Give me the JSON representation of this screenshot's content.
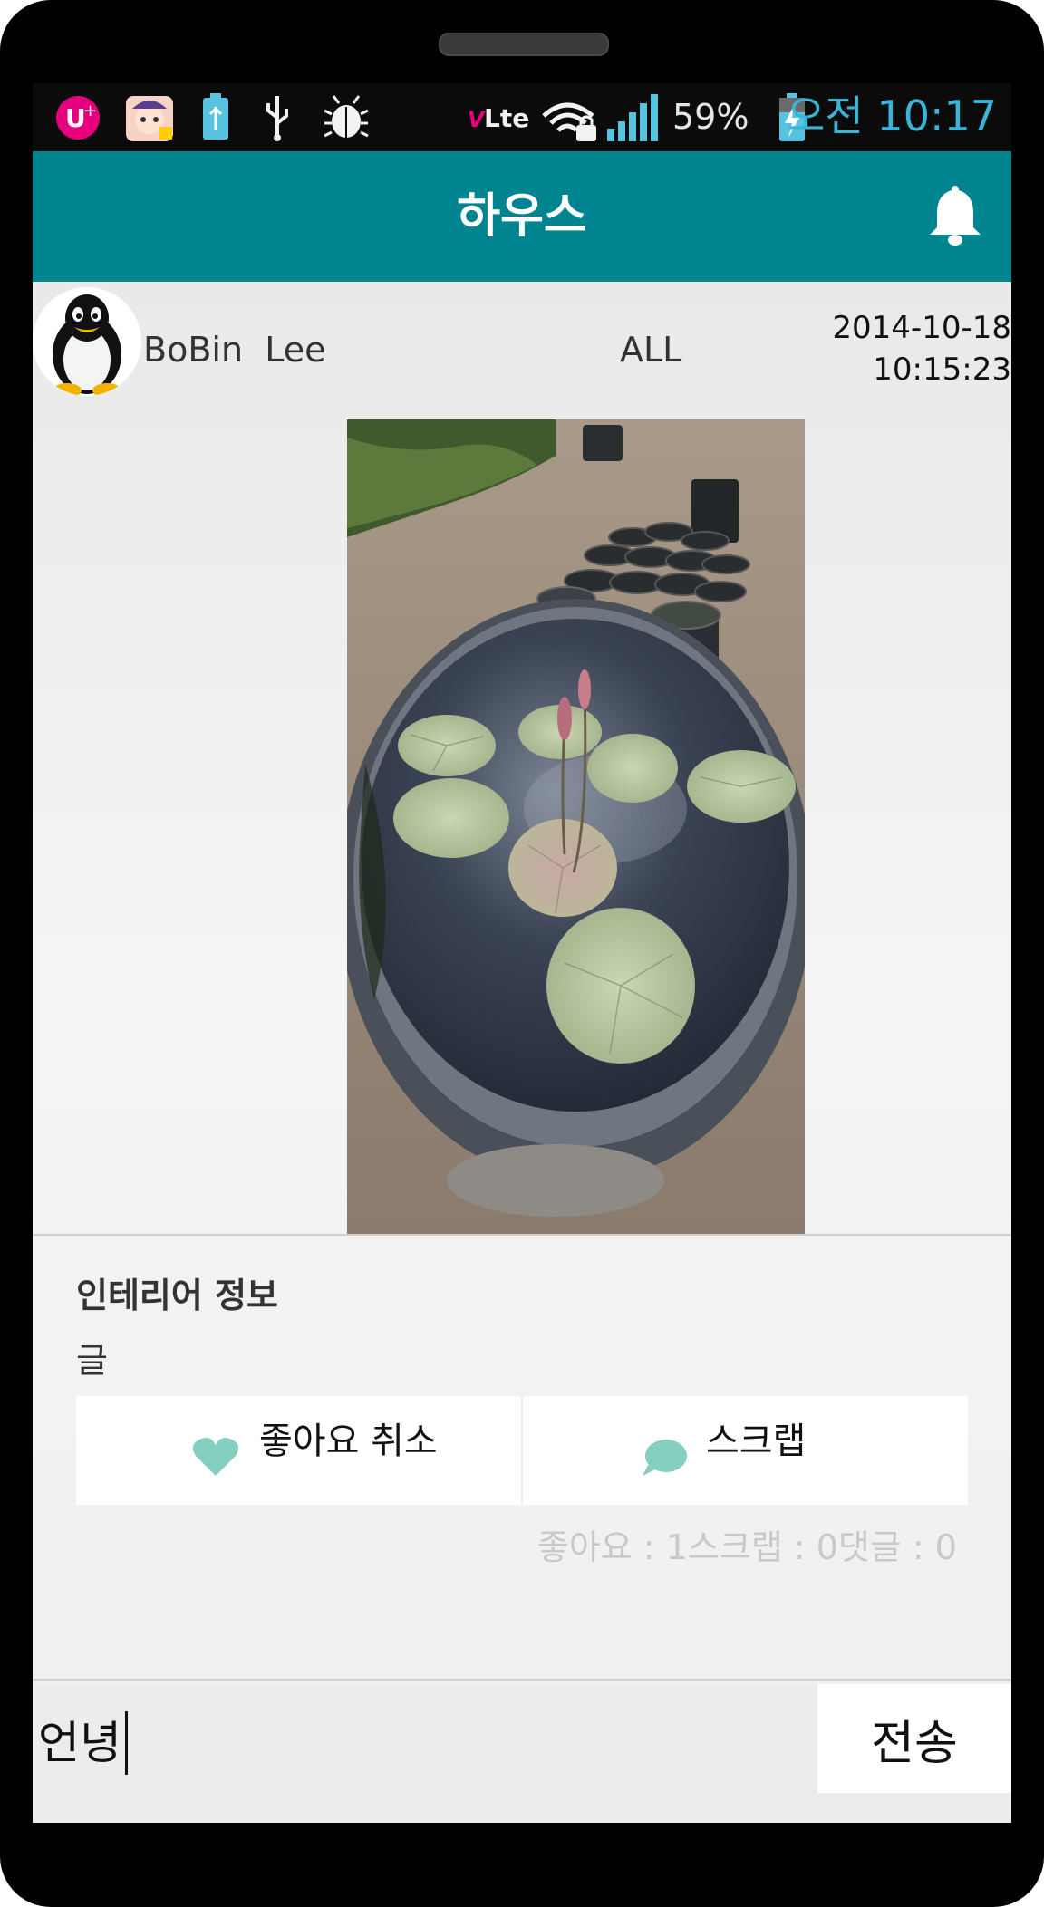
{
  "status_bar": {
    "carrier_logo": "U+",
    "network": "Lte",
    "battery": "59%",
    "time": "오전 10:17",
    "icons": [
      "uplus-icon",
      "app-icon",
      "battery-small-icon",
      "usb-icon",
      "bug-icon",
      "volte-icon",
      "wifi-lock-icon",
      "signal-icon",
      "battery-charging-icon"
    ]
  },
  "app_bar": {
    "title": "하우스",
    "bell_icon": "bell-icon"
  },
  "post": {
    "author": "BoBin  Lee",
    "audience": "ALL",
    "date": "2014-10-18",
    "time": "10:15:23",
    "category": "인테리어 정보",
    "body": "글",
    "like_button": "좋아요 취소",
    "scrap_button": "스크랩",
    "like_icon": "heart-icon",
    "scrap_icon": "speech-bubble-icon",
    "stats": "좋아요 : 1스크랩 : 0댓글 : 0"
  },
  "comment": {
    "input_value": "언녕",
    "send_label": "전송"
  },
  "colors": {
    "app_bar": "#00848f",
    "status_time": "#39b5d8",
    "accent_icon": "#84cfc0"
  }
}
